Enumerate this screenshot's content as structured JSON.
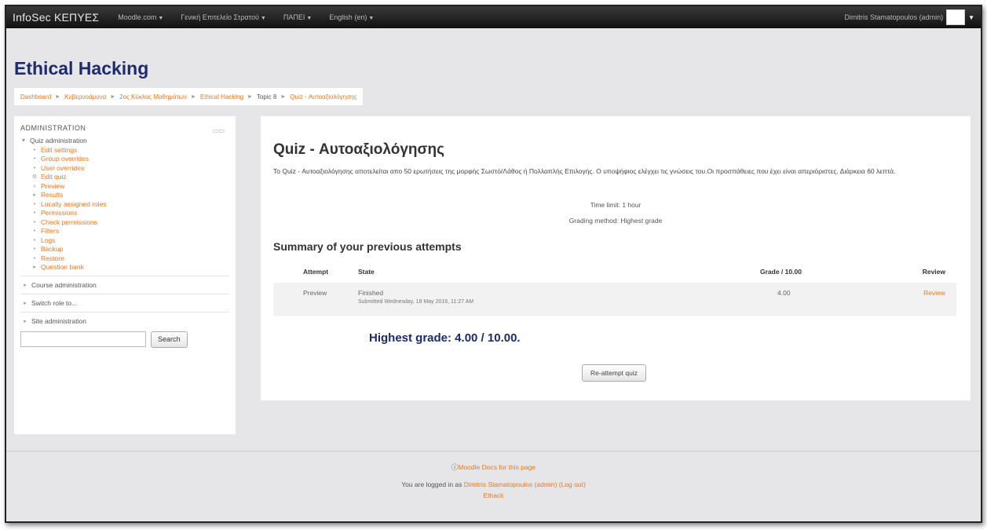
{
  "navbar": {
    "brand": "InfoSec ΚΕΠΥΕΣ",
    "menus": [
      "Moodle.com",
      "Γενική Επιτελείο Στρατού",
      "ΠΑΠΕΙ",
      "English (en)"
    ],
    "user": "Dimitris Stamatopoulos (admin)"
  },
  "site_title": "Ethical Hacking",
  "breadcrumb": [
    "Dashboard",
    "Κυβερνοάμυνα",
    "2ος Κύκλος Μαθημάτων",
    "Ethical Hacking",
    "Topic 8",
    "Quiz - Αυτοαξιολόγησης"
  ],
  "sidebar": {
    "title": "ADMINISTRATION",
    "quiz_admin": "Quiz administration",
    "items": [
      {
        "label": "Edit settings",
        "icon": "bullet"
      },
      {
        "label": "Group overrides",
        "icon": "bullet"
      },
      {
        "label": "User overrides",
        "icon": "bullet"
      },
      {
        "label": "Edit quiz",
        "icon": "gear"
      },
      {
        "label": "Preview",
        "icon": "search"
      },
      {
        "label": "Results",
        "icon": "triangle"
      },
      {
        "label": "Locally assigned roles",
        "icon": "bullet"
      },
      {
        "label": "Permissions",
        "icon": "bullet"
      },
      {
        "label": "Check permissions",
        "icon": "bullet"
      },
      {
        "label": "Filters",
        "icon": "bullet"
      },
      {
        "label": "Logs",
        "icon": "bullet"
      },
      {
        "label": "Backup",
        "icon": "bullet"
      },
      {
        "label": "Restore",
        "icon": "bullet"
      },
      {
        "label": "Question bank",
        "icon": "triangle"
      }
    ],
    "course_admin": "Course administration",
    "switch_role": "Switch role to...",
    "site_admin": "Site administration",
    "search_button": "Search",
    "search_value": ""
  },
  "main": {
    "quiz_title": "Quiz - Αυτοαξιολόγησης",
    "description": "Το Quiz - Αυτοαξιολόγησης αποτελείται απο 50 ερωτήσεις της μορφής Σωστό/Λάθος ή Πολλαπλής Επιλογής. Ο υποψήφιος ελέγχει τις γνώσεις του.Οι προσπάθειες που έχει είναι απεριόριστες. Διάρκεια 60 λεπτά.",
    "time_limit": "Time limit: 1 hour",
    "grading_method": "Grading method: Highest grade",
    "summary_title": "Summary of your previous attempts",
    "table_headers": [
      "Attempt",
      "State",
      "Grade / 10.00",
      "Review"
    ],
    "rows": [
      {
        "attempt": "Preview",
        "state": "Finished",
        "submitted": "Submitted Wednesday, 18 May 2016, 11:27 AM",
        "grade": "4.00",
        "review": "Review"
      }
    ],
    "highest_grade": "Highest grade: 4.00 / 10.00.",
    "reattempt_button": "Re-attempt quiz"
  },
  "footer": {
    "docs_link": "Moodle Docs for this page",
    "logged_in_prefix": "You are logged in as",
    "user_link": "Dimitris Stamatopoulos (admin)",
    "logout_link": "(Log out)",
    "course_short": "Ethack"
  },
  "colors": {
    "accent": "#e87a1e",
    "title": "#1e2a6e",
    "navbar": "#1a1a1a",
    "page_bg": "#e6e6e8"
  }
}
